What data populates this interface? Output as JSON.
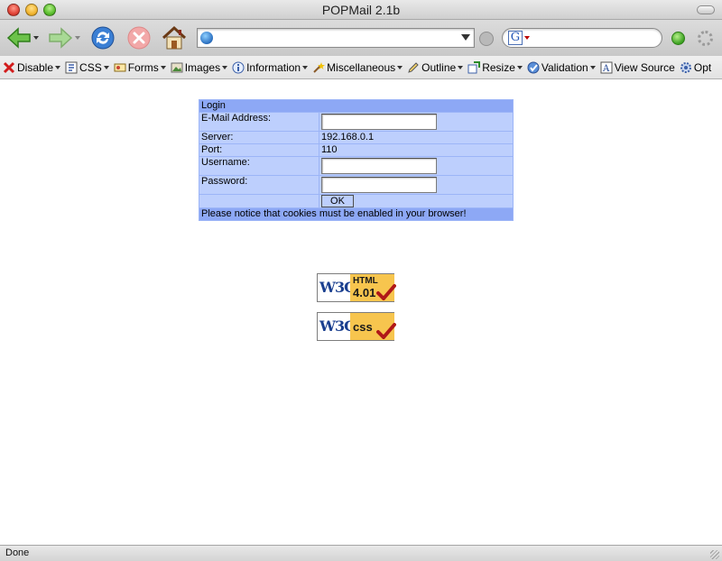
{
  "window": {
    "title": "POPMail 2.1b"
  },
  "navbar": {
    "url_value": "",
    "search_value": "",
    "icons": [
      "back-icon",
      "forward-icon",
      "reload-icon",
      "stop-icon",
      "home-icon",
      "globe-icon",
      "go-icon",
      "google-icon",
      "search-go-icon",
      "throbber-icon"
    ]
  },
  "devtoolbar": {
    "items": [
      {
        "label": "Disable",
        "icon": "disable-icon",
        "has_menu": true
      },
      {
        "label": "CSS",
        "icon": "css-icon",
        "has_menu": true
      },
      {
        "label": "Forms",
        "icon": "forms-icon",
        "has_menu": true
      },
      {
        "label": "Images",
        "icon": "images-icon",
        "has_menu": true
      },
      {
        "label": "Information",
        "icon": "information-icon",
        "has_menu": true
      },
      {
        "label": "Miscellaneous",
        "icon": "miscellaneous-icon",
        "has_menu": true
      },
      {
        "label": "Outline",
        "icon": "outline-icon",
        "has_menu": true
      },
      {
        "label": "Resize",
        "icon": "resize-icon",
        "has_menu": true
      },
      {
        "label": "Validation",
        "icon": "validation-icon",
        "has_menu": true
      },
      {
        "label": "View Source",
        "icon": "view-source-icon",
        "has_menu": false
      },
      {
        "label": "Opt",
        "icon": "options-icon",
        "has_menu": false
      }
    ]
  },
  "login": {
    "header": "Login",
    "email_label": "E-Mail Address:",
    "email_value": "",
    "server_label": "Server:",
    "server_value": "192.168.0.1",
    "port_label": "Port:",
    "port_value": "110",
    "username_label": "Username:",
    "username_value": "",
    "password_label": "Password:",
    "password_value": "",
    "ok_label": "OK",
    "notice": "Please notice that cookies must be enabled in your browser!"
  },
  "badges": {
    "html": {
      "logo": "W3C",
      "line1": "HTML",
      "line2": "4.01"
    },
    "css": {
      "logo": "W3C",
      "line1": "",
      "line2": "css"
    }
  },
  "status": {
    "text": "Done"
  },
  "colors": {
    "header": "#8da8f5",
    "row": "#bdcffd",
    "badge": "#f7c54e",
    "check": "#b01818"
  }
}
